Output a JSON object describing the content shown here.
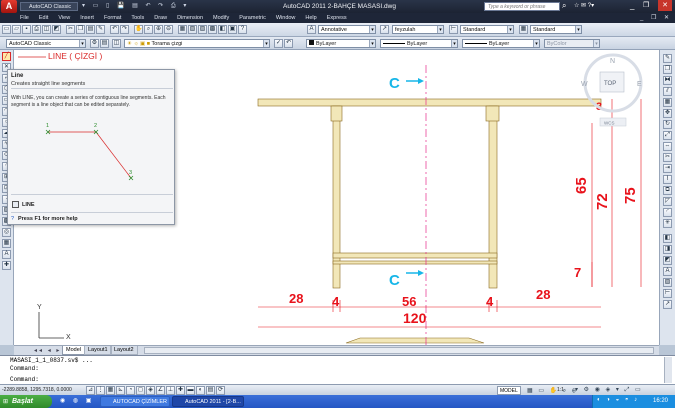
{
  "window": {
    "workspace": "AutoCAD Classic",
    "title": "AutoCAD 2011   2-BAHÇE MASASI.dwg",
    "search_placeholder": "Type a keyword or phrase"
  },
  "menu": [
    "File",
    "Edit",
    "View",
    "Insert",
    "Format",
    "Tools",
    "Draw",
    "Dimension",
    "Modify",
    "Parametric",
    "Window",
    "Help",
    "Express"
  ],
  "styles": {
    "annotative": "Annotative",
    "text_style": "feyzulah",
    "dim_style": "Standard",
    "table_style": "Standard"
  },
  "layers": {
    "workspace": "AutoCAD Classic",
    "current_layer": "Torama çizgi",
    "color": "ByLayer",
    "linetype": "ByLayer",
    "lineweight": "ByLayer",
    "plotstyle": "ByColor"
  },
  "annotation": {
    "line_callout": "LINE ( ÇİZGİ )"
  },
  "tooltip": {
    "title": "Line",
    "subtitle": "Creates straight line segments",
    "body": "With LINE, you can create a series of contiguous line segments. Each segment is a line object that can be edited separately.",
    "pt1": "1",
    "pt2": "2",
    "pt3": "3",
    "command_name": "LINE",
    "help": "Press F1 for more help"
  },
  "viewcube": {
    "north": "N",
    "west": "W",
    "east": "E",
    "top": "TOP",
    "wcs": "WCS"
  },
  "drawing": {
    "section_marker": "C",
    "dims": {
      "d3": "3",
      "d65": "65",
      "d72": "72",
      "d75": "75",
      "d7": "7",
      "d28a": "28",
      "d4a": "4",
      "d56": "56",
      "d4b": "4",
      "d28b": "28",
      "d120": "120"
    }
  },
  "tabs": {
    "model": "Model",
    "layout1": "Layout1",
    "layout2": "Layout2"
  },
  "command": {
    "line1": "MASASI_1_1_0837.sv$ ...",
    "line2": "Command:",
    "line3": "Command:"
  },
  "status": {
    "coords": "-2289.8858, 1295.7318, 0.0000",
    "model": "MODEL",
    "scale": "1:1"
  },
  "taskbar": {
    "start": "Başlat",
    "task1": "AUTOCAD ÇİZİMLER",
    "task2": "AutoCAD 2011 - [2-B...",
    "clock": "16:20"
  },
  "colors": {
    "dimension": "#e8121b",
    "section_marker": "#17b6e8",
    "wood": "#f2e7b8",
    "accent": "#d92a2a"
  }
}
